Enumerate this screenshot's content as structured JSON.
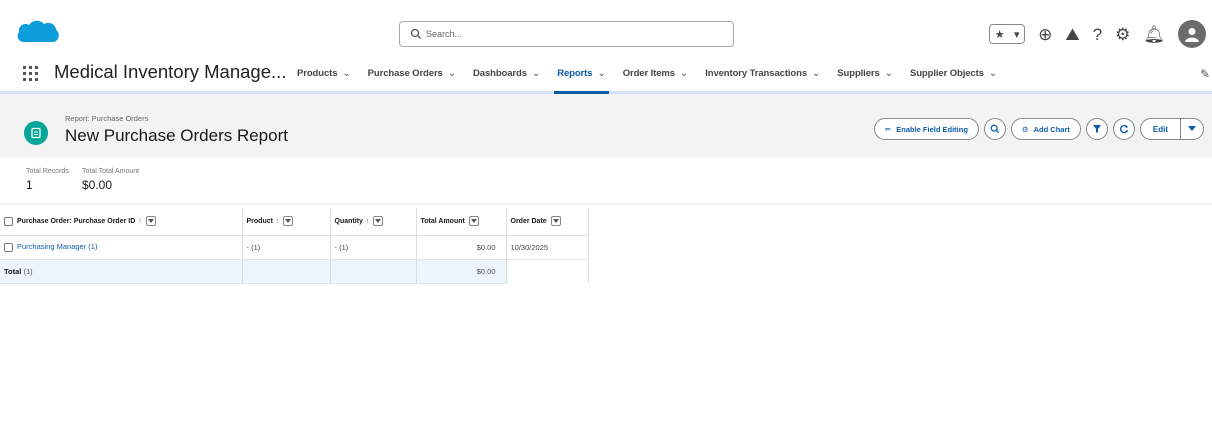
{
  "global": {
    "search_placeholder": "Search..."
  },
  "app": {
    "name": "Medical Inventory Manage...",
    "tabs": [
      {
        "label": "Products",
        "active": false
      },
      {
        "label": "Purchase Orders",
        "active": false
      },
      {
        "label": "Dashboards",
        "active": false
      },
      {
        "label": "Reports",
        "active": true
      },
      {
        "label": "Order Items",
        "active": false
      },
      {
        "label": "Inventory Transactions",
        "active": false
      },
      {
        "label": "Suppliers",
        "active": false
      },
      {
        "label": "Supplier Objects",
        "active": false
      }
    ]
  },
  "report": {
    "type_label": "Report: Purchase Orders",
    "title": "New Purchase Orders Report",
    "actions": {
      "enable_field_editing": "Enable Field Editing",
      "add_chart": "Add Chart",
      "edit": "Edit"
    },
    "summary": {
      "total_records_label": "Total Records",
      "total_records_value": "1",
      "total_amount_label": "Total Total Amount",
      "total_amount_value": "$0.00"
    },
    "columns": [
      {
        "label": "Purchase Order: Purchase Order ID",
        "sort": "↑"
      },
      {
        "label": "Product",
        "sort": "↑"
      },
      {
        "label": "Quantity",
        "sort": "↑"
      },
      {
        "label": "Total Amount",
        "sort": ""
      },
      {
        "label": "Order Date",
        "sort": ""
      }
    ],
    "rows": [
      {
        "po_id": "Purchasing Manager (1)",
        "product": "- (1)",
        "quantity": "- (1)",
        "total_amount": "$0.00",
        "order_date": "10/30/2025"
      }
    ],
    "total_row": {
      "label": "Total",
      "count": "(1)",
      "total_amount": "$0.00"
    }
  },
  "colors": {
    "brand_blue": "#0b5cab",
    "cloud": "#0d9dda",
    "report_icon": "#06a59a"
  }
}
